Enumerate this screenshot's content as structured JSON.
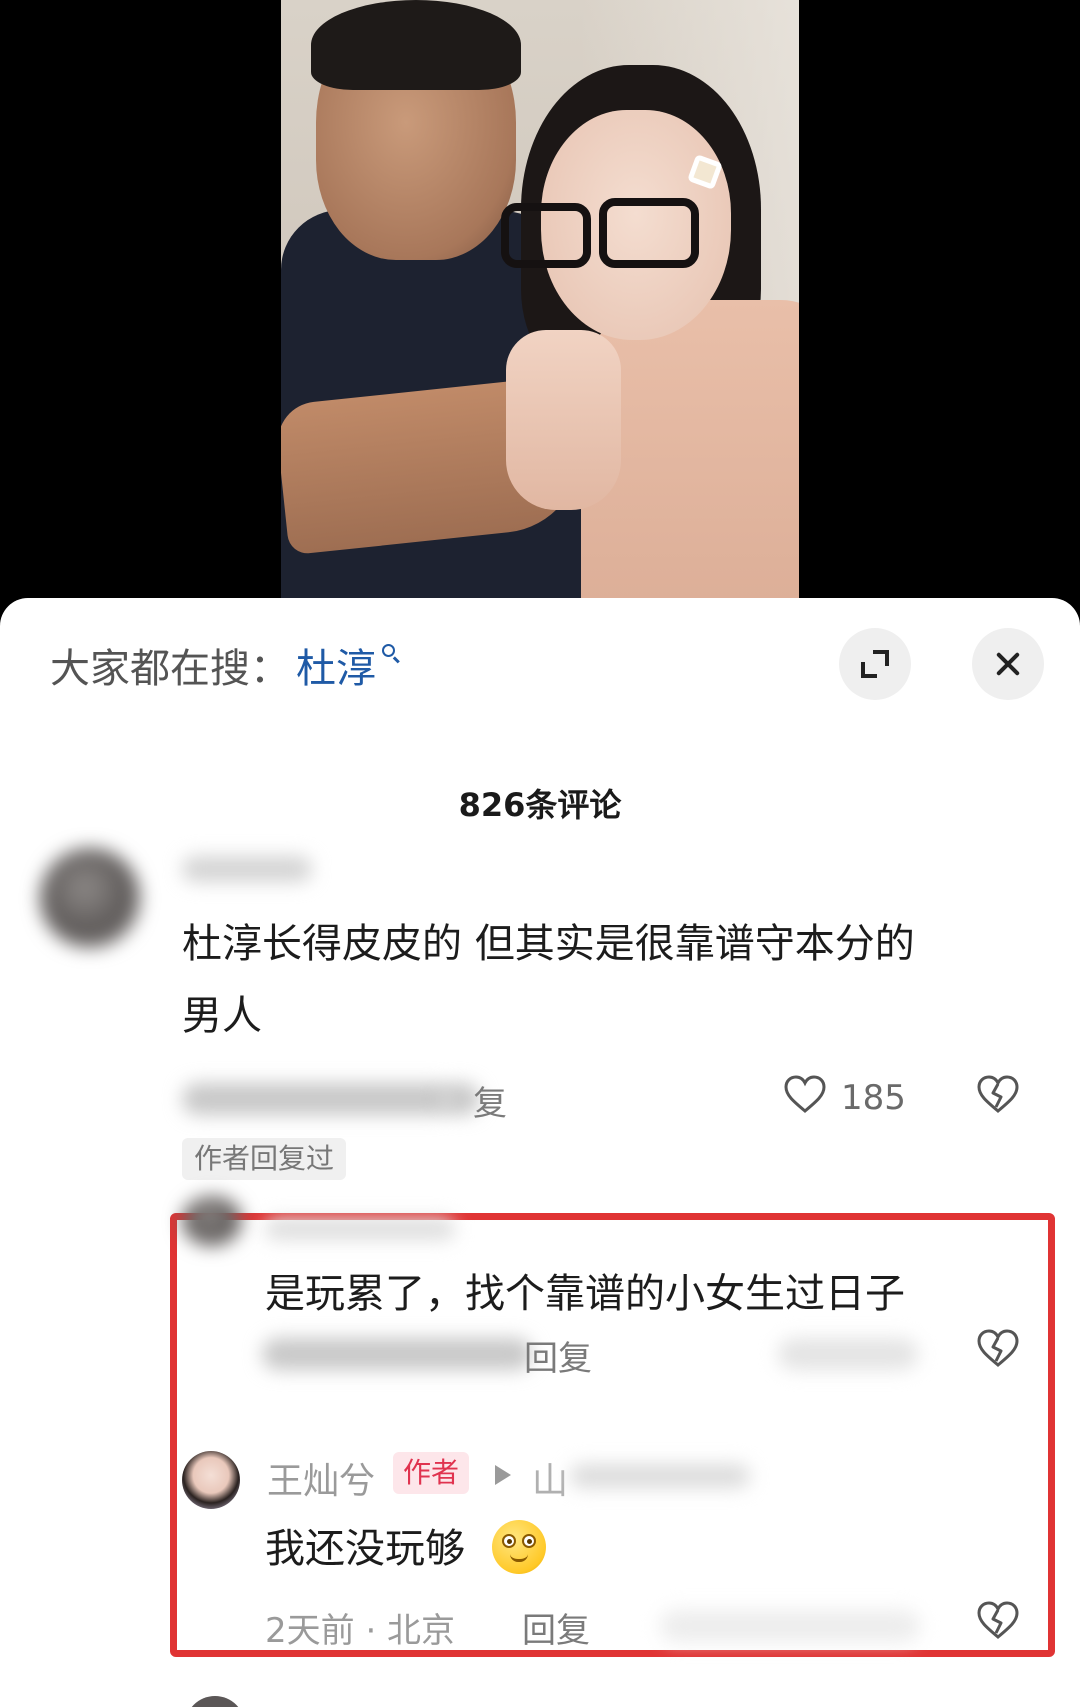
{
  "search_bar": {
    "prefix": "大家都在搜：",
    "term": "杜淳"
  },
  "comments_header": {
    "count_title": "826条评论"
  },
  "comments": [
    {
      "text_line1": "杜淳长得皮皮的 但其实是很靠谱守本分的",
      "text_line2": "男人",
      "reply_label": "复",
      "like_count": "185",
      "author_replied_tag": "作者回复过"
    },
    {
      "text": "是玩累了，找个靠谱的小女生过日子",
      "reply_label": "回复"
    },
    {
      "author_name": "王灿兮",
      "author_badge": "作者",
      "reply_target_visible": "山",
      "text": "我还没玩够",
      "emoji": "smiling-face-emoji",
      "meta": "2天前 · 北京",
      "reply_label": "回复"
    }
  ],
  "icons": {
    "search": "search-icon",
    "expand": "expand-icon",
    "close": "close-icon",
    "like": "heart-icon",
    "dislike": "broken-heart-icon"
  },
  "colors": {
    "link_blue": "#1f5aa6",
    "highlight_red": "#e03434",
    "author_badge_text": "#e0334f"
  }
}
